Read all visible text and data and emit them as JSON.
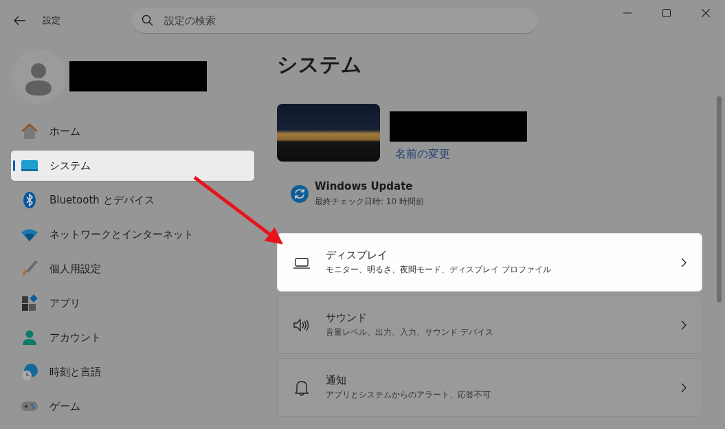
{
  "window": {
    "title": "設定"
  },
  "search": {
    "placeholder": "設定の検索"
  },
  "sidebar": {
    "items": [
      {
        "label": "ホーム",
        "kind": "home",
        "selected": false
      },
      {
        "label": "システム",
        "kind": "system",
        "selected": true
      },
      {
        "label": "Bluetooth とデバイス",
        "kind": "bluetooth",
        "selected": false
      },
      {
        "label": "ネットワークとインターネット",
        "kind": "network",
        "selected": false
      },
      {
        "label": "個人用設定",
        "kind": "personalization",
        "selected": false
      },
      {
        "label": "アプリ",
        "kind": "apps",
        "selected": false
      },
      {
        "label": "アカウント",
        "kind": "accounts",
        "selected": false
      },
      {
        "label": "時刻と言語",
        "kind": "time",
        "selected": false
      },
      {
        "label": "ゲーム",
        "kind": "gaming",
        "selected": false
      }
    ]
  },
  "page": {
    "title": "システム",
    "rename_link": "名前の変更"
  },
  "update": {
    "title": "Windows Update",
    "subtitle": "最終チェック日時: 10 時間前"
  },
  "cards": [
    {
      "title": "ディスプレイ",
      "subtitle": "モニター、明るさ、夜間モード、ディスプレイ プロファイル",
      "kind": "display",
      "highlighted": true
    },
    {
      "title": "サウンド",
      "subtitle": "音量レベル、出力、入力、サウンド デバイス",
      "kind": "sound",
      "highlighted": false
    },
    {
      "title": "通知",
      "subtitle": "アプリとシステムからのアラート、応答不可",
      "kind": "notifications",
      "highlighted": false
    }
  ]
}
